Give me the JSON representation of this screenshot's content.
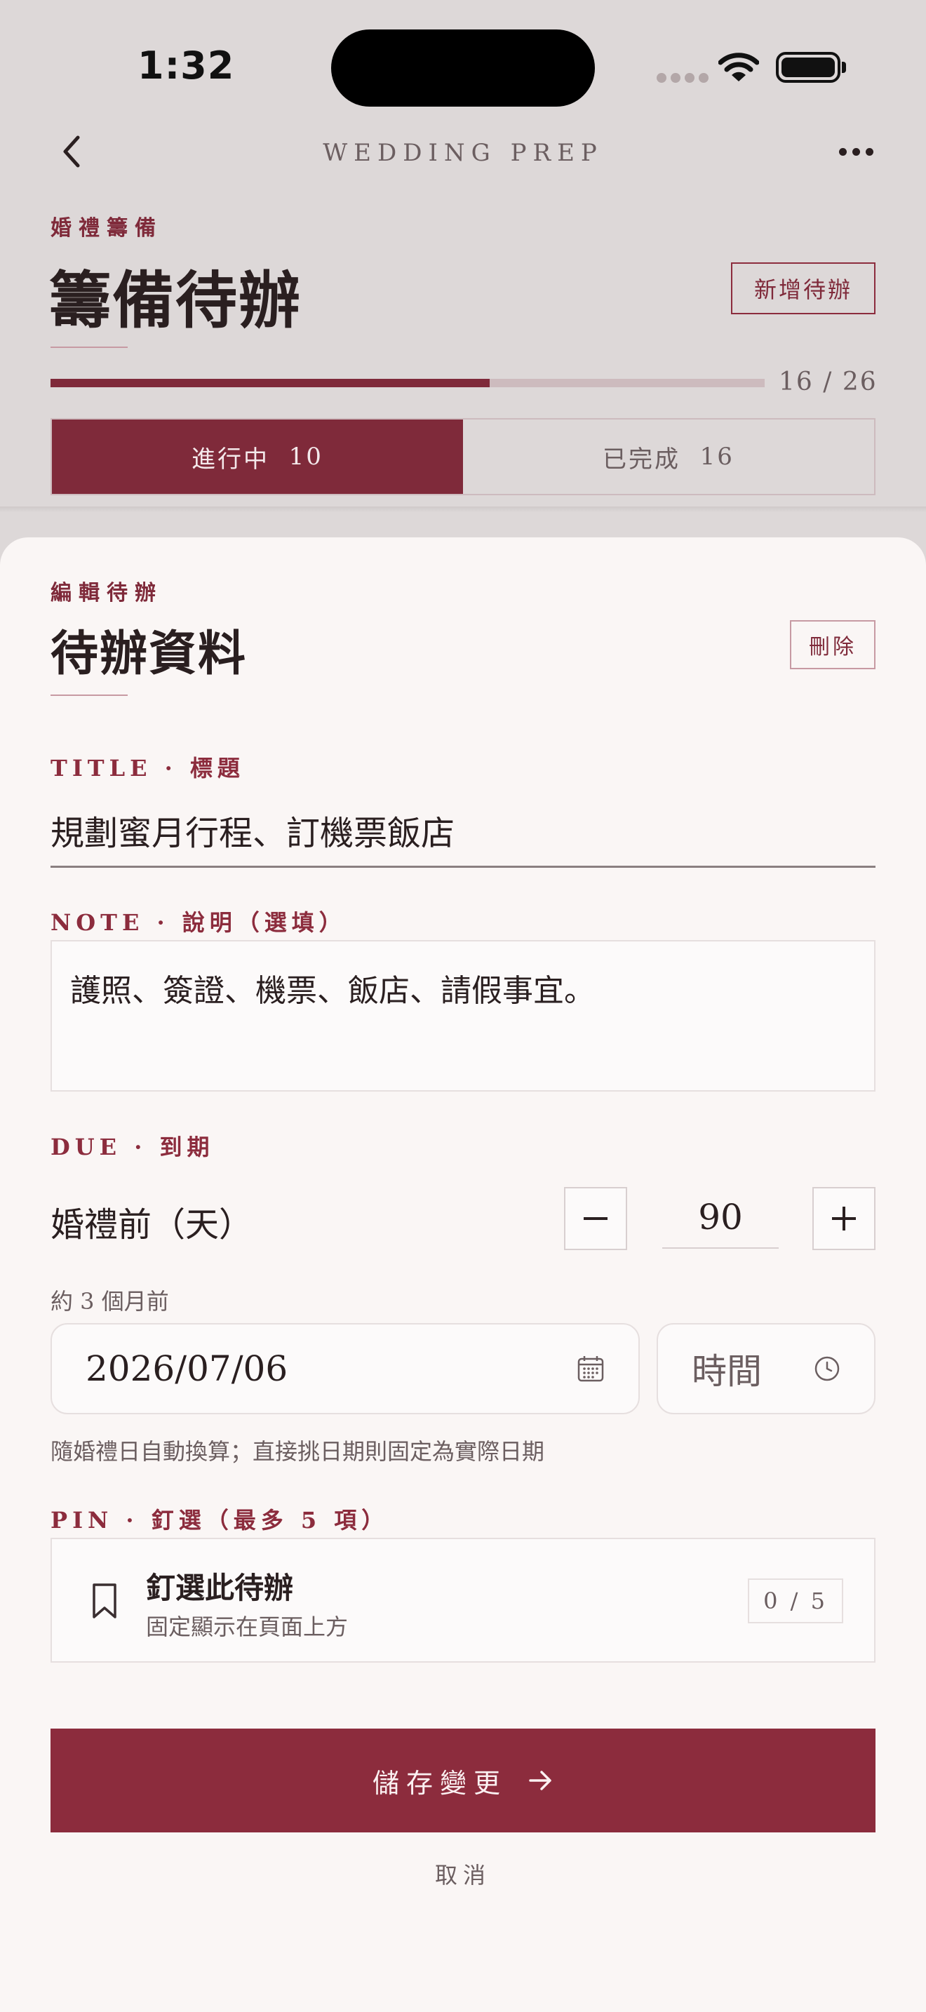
{
  "status_bar": {
    "time": "1:32"
  },
  "nav": {
    "title": "WEDDING PREP",
    "back_icon": "chevron-left-icon",
    "more_icon": "ellipsis-icon"
  },
  "header": {
    "eyebrow": "婚禮籌備",
    "title": "籌備待辦",
    "add_button": "新增待辦",
    "progress": {
      "done": 16,
      "total": 26,
      "label": "16 / 26"
    }
  },
  "segments": [
    {
      "label": "進行中",
      "count": "10",
      "active": true
    },
    {
      "label": "已完成",
      "count": "16",
      "active": false
    }
  ],
  "sheet": {
    "eyebrow": "編輯待辦",
    "title": "待辦資料",
    "delete_button": "刪除",
    "title_field": {
      "label": "TITLE · 標題",
      "value": "規劃蜜月行程、訂機票飯店"
    },
    "note_field": {
      "label": "NOTE · 說明（選填）",
      "value": "護照、簽證、機票、飯店、請假事宜。"
    },
    "due_field": {
      "label": "DUE · 到期",
      "text": "婚禮前（天）",
      "minus": "−",
      "plus": "+",
      "days": "90",
      "approx": "約 3 個月前",
      "date": "2026/07/06",
      "time_placeholder": "時間",
      "hint": "隨婚禮日自動換算；直接挑日期則固定為實際日期"
    },
    "pin_field": {
      "label": "PIN · 釘選（最多 5 項）",
      "title": "釘選此待辦",
      "subtitle": "固定顯示在頁面上方",
      "count": "0 / 5"
    },
    "save_button": "儲存變更",
    "cancel_button": "取消"
  },
  "colors": {
    "accent": "#8c2c3d",
    "background": "#faf6f5",
    "dim_overlay": "#ddd8d8"
  }
}
